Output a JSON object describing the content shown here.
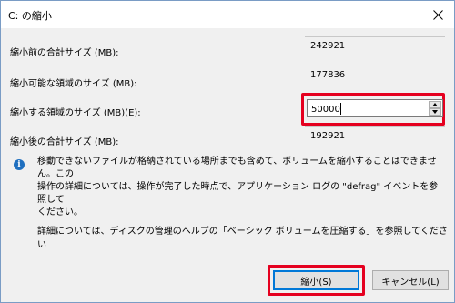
{
  "window": {
    "title": "C: の縮小",
    "close_icon": "close-icon"
  },
  "fields": {
    "total_before": {
      "label": "縮小前の合計サイズ (MB):",
      "value": "242921"
    },
    "shrinkable": {
      "label": "縮小可能な領域のサイズ (MB):",
      "value": "177836"
    },
    "shrink_amount": {
      "label": "縮小する領域のサイズ (MB)(E):",
      "value": "50000"
    },
    "total_after": {
      "label": "縮小後の合計サイズ (MB):",
      "value": "192921"
    }
  },
  "info": {
    "icon": "info-icon",
    "text": "移動できないファイルが格納されている場所までも含めて、ボリュームを縮小することはできません。この\n操作の詳細については、操作が完了した時点で、アプリケーション ログの \"defrag\" イベントを参照して\nください。"
  },
  "help_text": "詳細については、ディスクの管理のヘルプの「ベーシック ボリュームを圧縮する」を参照してください",
  "buttons": {
    "shrink": "縮小(S)",
    "cancel": "キャンセル(L)"
  },
  "colors": {
    "highlight": "#e5001f",
    "focus_border": "#0078d7",
    "info_icon": "#1f6fbf"
  }
}
